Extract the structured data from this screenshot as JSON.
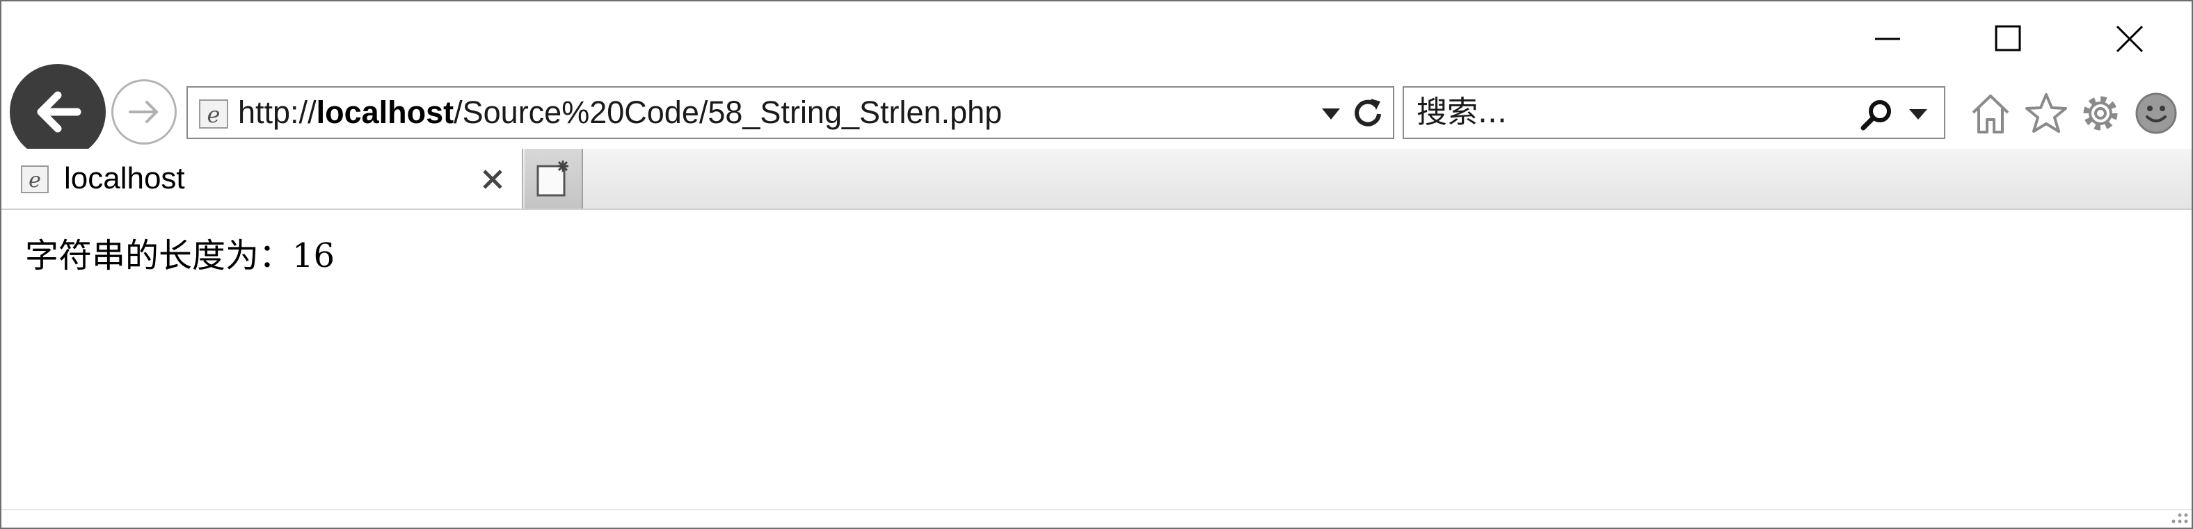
{
  "window": {
    "caption_buttons": [
      "minimize",
      "maximize",
      "close"
    ]
  },
  "nav": {
    "back_icon": "back-arrow-icon",
    "forward_icon": "forward-arrow-icon"
  },
  "address_bar": {
    "url_prefix": "http://",
    "url_host": "localhost",
    "url_path": "/Source%20Code/58_String_Strlen.php",
    "site_icon": "ie-page-icon"
  },
  "search": {
    "placeholder": "搜索..."
  },
  "toolbar": {
    "icons": [
      "home-icon",
      "star-icon",
      "gear-icon",
      "smiley-icon"
    ]
  },
  "tabs": [
    {
      "title": "localhost",
      "active": true
    }
  ],
  "page": {
    "text": "字符串的长度为：16"
  },
  "colors": {
    "back_button": "#3c3c3c",
    "border": "#8a8a8a",
    "text": "#000000"
  }
}
